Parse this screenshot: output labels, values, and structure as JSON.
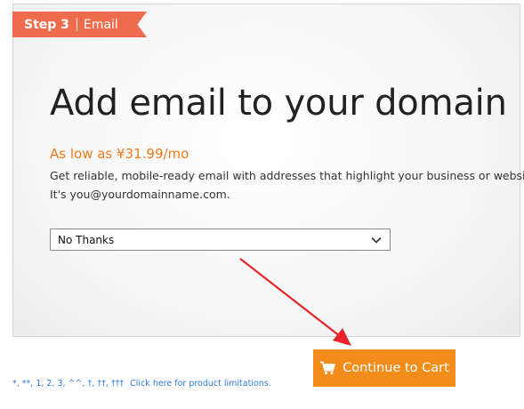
{
  "step": {
    "label": "Step 3",
    "name": "Email"
  },
  "main": {
    "heading": "Add email to your domain",
    "price": "As low as ¥31.99/mo",
    "description_line1": "Get reliable, mobile-ready email with addresses that highlight your business or website.",
    "description_line2": "It's you@yourdomainname.com."
  },
  "email_select": {
    "selected": "No Thanks"
  },
  "cart_button": {
    "label": "Continue to Cart",
    "icon": "cart-icon"
  },
  "footnote": {
    "symbols": "*, **, 1, 2, 3, ^^, †, ††, †††",
    "link": "Click here for product limitations."
  },
  "colors": {
    "ribbon": "#ee6c4d",
    "price": "#ef7a1a",
    "button": "#f28c1a",
    "link": "#2d7bd8",
    "arrow": "#e8232a"
  }
}
